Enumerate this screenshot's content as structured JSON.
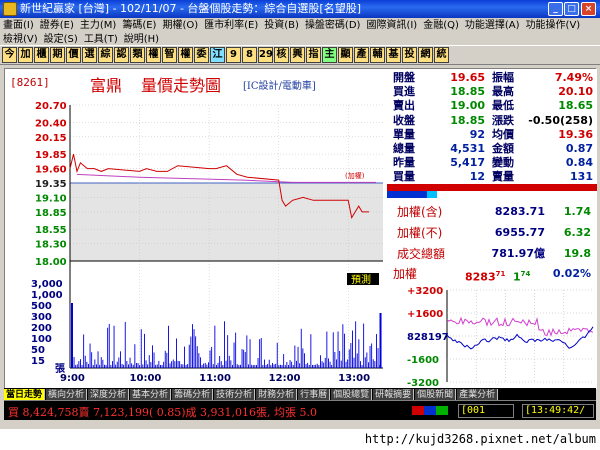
{
  "window": {
    "title": "新世紀贏家 [台灣] - 102/11/07 - 台盤個股走勢：綜合自選股[名望股]",
    "buttons": [
      "_",
      "□",
      "×"
    ]
  },
  "menu": {
    "row1": [
      "畫面(I)",
      "證券(E)",
      "主力(M)",
      "籌碼(E)",
      "期權(O)",
      "匯市利率(E)",
      "投資(B)",
      "操盤密碼(D)",
      "國際資訊(I)",
      "金融(Q)",
      "功能選擇(A)",
      "功能操作(V)"
    ],
    "row2": [
      "檢視(V)",
      "設定(S)",
      "工具(T)",
      "說明(H)"
    ]
  },
  "toolbar": {
    "buttons": [
      "今",
      "加",
      "櫃",
      "期",
      "價",
      "選",
      "綜",
      "認",
      "類",
      "權",
      "智",
      "權",
      "委",
      "江",
      "9",
      "8",
      "29",
      "核",
      "興",
      "指",
      "主",
      "顯",
      "產",
      "輔",
      "基",
      "投",
      "網",
      "統"
    ],
    "colors": [
      "#ffe080",
      "#ffe080",
      "#ffe080",
      "#ffe080",
      "#ffe080",
      "#ffe080",
      "#ffe080",
      "#ffe080",
      "#ffe080",
      "#ffe080",
      "#ffe080",
      "#ffe080",
      "#ffe080",
      "#80e0ff",
      "#ffe080",
      "#ffe080",
      "#ffe080",
      "#ffe080",
      "#ffe080",
      "#ffe080",
      "#80ff80",
      "#ffe080",
      "#ffe080",
      "#ffe080",
      "#ffe080",
      "#ffe080",
      "#ffe080",
      "#ffe080"
    ]
  },
  "stock": {
    "code": "[8261]",
    "name_a": "富鼎",
    "name_b": "量價走勢圖",
    "industry": "[IC設計/電動車]",
    "ref_label": "(加權)",
    "forecast_label": "預測"
  },
  "quote": {
    "rows": [
      {
        "l1": "開盤",
        "v1": "19.65",
        "c1": "red",
        "l2": "振幅",
        "v2": "7.49%",
        "c2": "red"
      },
      {
        "l1": "買進",
        "v1": "18.85",
        "c1": "green",
        "l2": "最高",
        "v2": "20.10",
        "c2": "red"
      },
      {
        "l1": "賣出",
        "v1": "19.00",
        "c1": "green",
        "l2": "最低",
        "v2": "18.65",
        "c2": "green"
      },
      {
        "l1": "收盤",
        "v1": "18.85",
        "c1": "green",
        "l2": "漲跌",
        "v2": "-0.50(258)",
        "c2": "dark"
      },
      {
        "l1": "單量",
        "v1": "92",
        "c1": "blue",
        "l2": "均價",
        "v2": "19.36",
        "c2": "red"
      },
      {
        "l1": "總量",
        "v1": "4,531",
        "c1": "blue",
        "l2": "金額",
        "v2": "0.87",
        "c2": "blue"
      },
      {
        "l1": "昨量",
        "v1": "5,417",
        "c1": "blue",
        "l2": "變動",
        "v2": "0.84",
        "c2": "blue"
      },
      {
        "l1": "買量",
        "v1": "12",
        "c1": "blue",
        "l2": "賣量",
        "v2": "131",
        "c2": "blue"
      }
    ]
  },
  "index": {
    "rows": [
      {
        "label": "加權(含)",
        "value": "8283.71",
        "change": "1.74"
      },
      {
        "label": "加權(不)",
        "value": "6955.77",
        "change": "6.32"
      },
      {
        "label": "成交總額",
        "value": "781.97億",
        "change": "19.8"
      }
    ],
    "mini_label": "加權",
    "mini_value": "8283",
    "mini_value_sup": "71",
    "mini_change": "1",
    "mini_change_sup": "74",
    "mini_pct": "0.02%",
    "mini_ticks": [
      "+3200",
      "+1600",
      "828197",
      "-1600",
      "-3200"
    ]
  },
  "chart_data": {
    "type": "line",
    "title": "富鼎 量價走勢圖",
    "price_ticks": [
      "20.70",
      "20.40",
      "20.15",
      "19.85",
      "19.60",
      "19.35",
      "19.10",
      "18.85",
      "18.55",
      "18.30",
      "18.00"
    ],
    "volume_ticks": [
      "3,000",
      "1,000",
      "500",
      "300",
      "200",
      "100",
      "50",
      "15"
    ],
    "volume_unit": "張",
    "x_ticks": [
      "9:00",
      "10:00",
      "11:00",
      "12:00",
      "13:00"
    ],
    "ylim": [
      18.0,
      20.7
    ],
    "reference_price": 19.35,
    "series": [
      {
        "name": "price",
        "x": [
          9.0,
          9.05,
          9.1,
          9.15,
          9.25,
          9.35,
          9.45,
          9.55,
          10.0,
          10.1,
          10.25,
          10.4,
          10.55,
          11.0,
          11.1,
          11.25,
          11.4,
          11.55,
          12.0,
          12.05,
          12.1,
          12.2,
          12.35,
          12.5,
          13.0,
          13.05,
          13.1,
          13.15,
          13.2,
          13.3
        ],
        "values": [
          19.6,
          19.85,
          19.55,
          19.7,
          19.6,
          19.6,
          19.55,
          19.6,
          19.55,
          19.6,
          19.55,
          19.55,
          19.65,
          19.6,
          19.6,
          19.65,
          19.5,
          19.45,
          19.4,
          19.05,
          18.95,
          19.05,
          19.1,
          19.05,
          19.05,
          18.75,
          18.85,
          18.95,
          18.85,
          18.85
        ]
      }
    ]
  },
  "tabs": [
    "當日走勢",
    "橫向分析",
    "深度分析",
    "基本分析",
    "籌碼分析",
    "技術分析",
    "財務分析",
    "行事曆",
    "個股總覽",
    "研報摘要",
    "個股新聞",
    "產業分析"
  ],
  "status": {
    "tick_line": "買 8,424,758賣 7,123,199( 0.85)成 3,931,016張, 均張 5.0",
    "msg_box": "[001",
    "clock": "[13:49:42/"
  },
  "watermark": "http://kujd3268.pixnet.net/album",
  "colors": {
    "rise": "#d00000",
    "fall": "#008800",
    "volume": "#0000e0",
    "average": "#c040c0"
  }
}
